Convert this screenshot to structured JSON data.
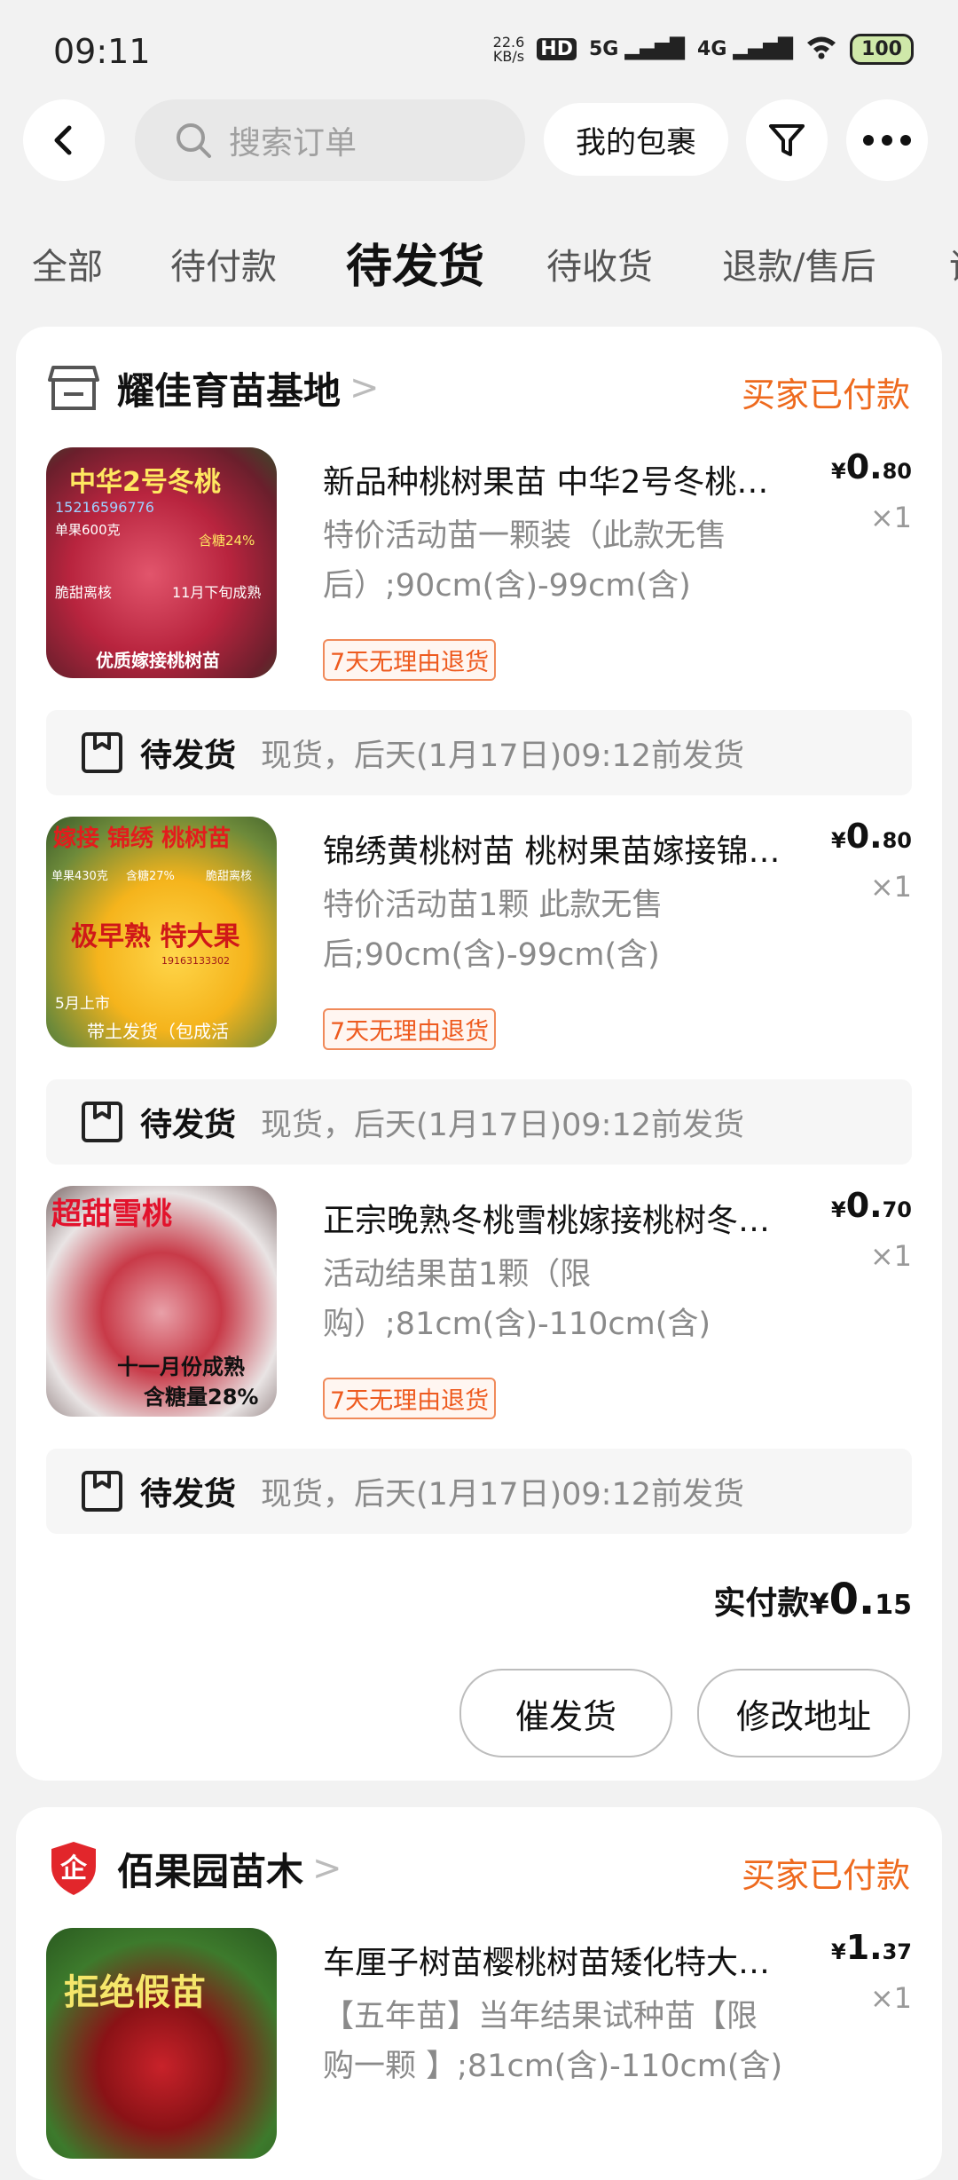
{
  "status": {
    "time": "09:11",
    "net_speed": "22.6",
    "net_unit": "KB/s",
    "hd": "HD",
    "sig1": "5G",
    "sig2": "4G",
    "battery": "100"
  },
  "header": {
    "search_placeholder": "搜索订单",
    "my_packages": "我的包裹"
  },
  "tabs": [
    "全部",
    "待付款",
    "待发货",
    "待收货",
    "退款/售后"
  ],
  "active_tab": "待发货",
  "orders": [
    {
      "shop": "耀佳育苗基地",
      "status": "买家已付款",
      "items": [
        {
          "title": "新品种桃树果苗 中华2号冬桃…",
          "spec_line1": "特价活动苗一颗装（此款无售",
          "spec_line2": "后）;90cm(含)-99cm(含)",
          "badge": "7天无理由退货",
          "currency": "¥",
          "price_int": "0.",
          "price_dec": "80",
          "qty": "×1",
          "thumb": {
            "headline": "中华2号冬桃",
            "phone": "15216596776",
            "note1": "单果600克",
            "note2": "含糖24%",
            "note3": "脆甜离核",
            "note4": "11月下旬成熟",
            "footer": "优质嫁接桃树苗"
          },
          "ship_status": "待发货",
          "ship_desc": "现货，后天(1月17日)09:12前发货"
        },
        {
          "title": "锦绣黄桃树苗 桃树果苗嫁接锦…",
          "spec_line1": "特价活动苗1颗 此款无售",
          "spec_line2": "后;90cm(含)-99cm(含)",
          "badge": "7天无理由退货",
          "currency": "¥",
          "price_int": "0.",
          "price_dec": "80",
          "qty": "×1",
          "thumb": {
            "headline": "嫁接 锦绣 桃树苗",
            "note1": "单果430克",
            "note2": "含糖27%",
            "note3": "脆甜离核",
            "mid": "极早熟 特大果",
            "phone": "19163133302",
            "note4": "5月上市",
            "footer": "带土发货（包成活"
          },
          "ship_status": "待发货",
          "ship_desc": "现货，后天(1月17日)09:12前发货"
        },
        {
          "title": "正宗晚熟冬桃雪桃嫁接桃树冬…",
          "spec_line1": "活动结果苗1颗（限",
          "spec_line2": "购）;81cm(含)-110cm(含)",
          "badge": "7天无理由退货",
          "currency": "¥",
          "price_int": "0.",
          "price_dec": "70",
          "qty": "×1",
          "thumb": {
            "headline": "超甜雪桃",
            "mid": "十一月份成熟",
            "footer": "含糖量28%"
          },
          "ship_status": "待发货",
          "ship_desc": "现货，后天(1月17日)09:12前发货"
        }
      ],
      "total_label": "实付款",
      "total_currency": "¥",
      "total_int": "0.",
      "total_dec": "15",
      "actions": [
        "催发货",
        "修改地址"
      ]
    },
    {
      "shop": "佰果园苗木",
      "status": "买家已付款",
      "items": [
        {
          "title": "车厘子树苗樱桃树苗矮化特大…",
          "spec_line1": "【五年苗】当年结果试种苗【限",
          "spec_line2": "购一颗 】;81cm(含)-110cm(含)",
          "currency": "¥",
          "price_int": "1.",
          "price_dec": "37",
          "qty": "×1",
          "thumb": {
            "headline": "拒绝假苗"
          }
        }
      ]
    }
  ],
  "colors": {
    "accent": "#ee6a1e",
    "bg": "#f2f2f2"
  }
}
